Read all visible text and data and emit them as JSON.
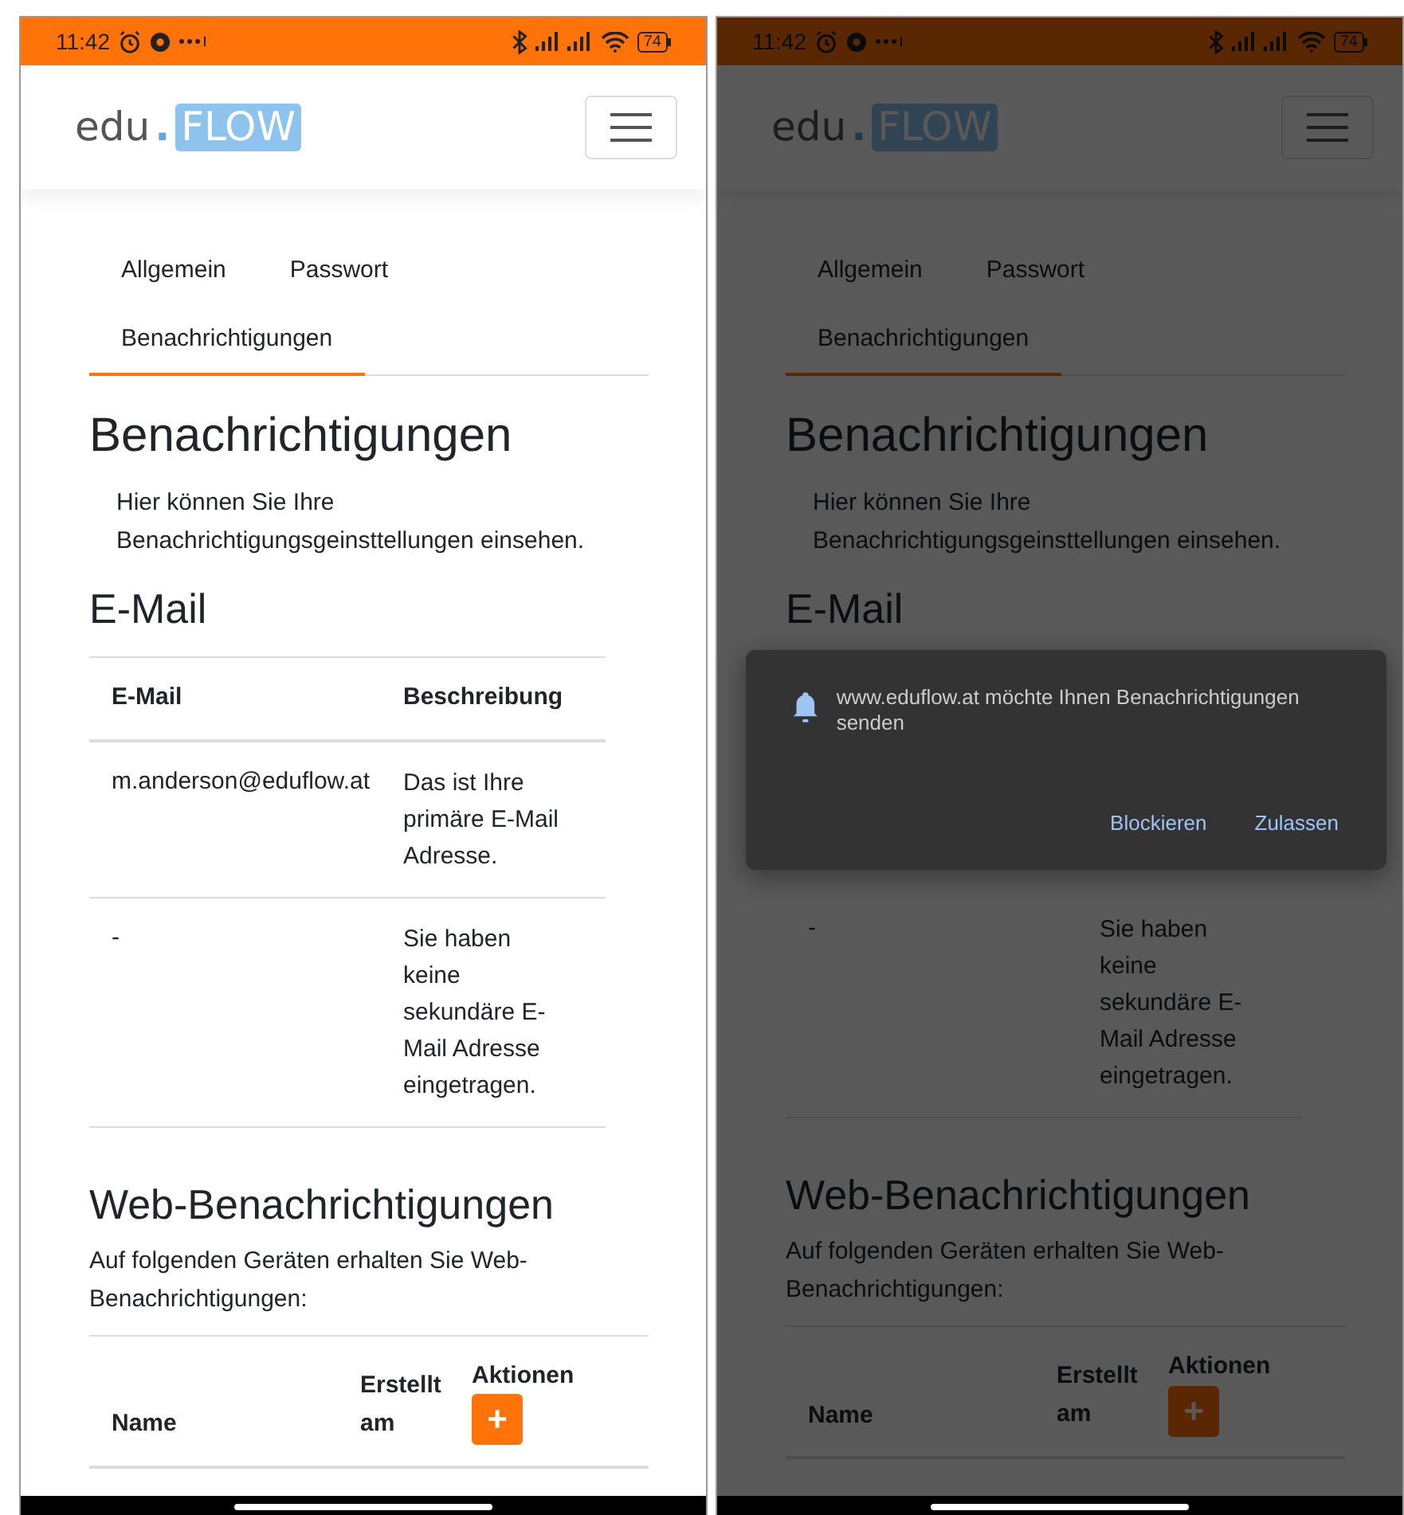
{
  "screens": [
    {
      "status_bar": {
        "time": "11:42",
        "battery": "74"
      },
      "logo": {
        "prefix": "edu",
        "dot": ".",
        "highlight": "FLOW"
      },
      "tabs": [
        {
          "label": "Allgemein",
          "selected": false
        },
        {
          "label": "Passwort",
          "selected": false
        },
        {
          "label": "Benachrichtigungen",
          "selected": true
        }
      ],
      "title": "Benachrichtigungen",
      "intro": "Hier können Sie Ihre Benachrichtigungsgeinsttellungen einsehen.",
      "email_section": {
        "heading": "E-Mail",
        "columns": [
          "E-Mail",
          "Beschreibung"
        ],
        "rows": [
          {
            "email": "m.anderson@eduflow.at",
            "description": "Das ist Ihre primäre E-Mail Adresse."
          },
          {
            "email": "-",
            "description": "Sie haben keine sekundäre E-Mail Adresse eingetragen."
          }
        ]
      },
      "web_section": {
        "heading": "Web-Benachrichtigungen",
        "intro": "Auf folgenden Geräten erhalten Sie Web-Benachrichtigungen:",
        "columns": [
          "Name",
          "Erstellt am",
          "Aktionen"
        ],
        "add_button": "+"
      }
    },
    {
      "status_bar": {
        "time": "11:42",
        "battery": "74"
      },
      "logo": {
        "prefix": "edu",
        "dot": ".",
        "highlight": "FLOW"
      },
      "tabs": [
        {
          "label": "Allgemein",
          "selected": false
        },
        {
          "label": "Passwort",
          "selected": false
        },
        {
          "label": "Benachrichtigungen",
          "selected": true
        }
      ],
      "title": "Benachrichtigungen",
      "intro": "Hier können Sie Ihre Benachrichtigungsgeinsttellungen einsehen.",
      "email_section": {
        "heading": "E-Mail",
        "rows": [
          {
            "email": "-",
            "description": "Sie haben keine sekundäre E-Mail Adresse eingetragen."
          }
        ]
      },
      "web_section": {
        "heading": "Web-Benachrichtigungen",
        "intro": "Auf folgenden Geräten erhalten Sie Web-Benachrichtigungen:",
        "columns": [
          "Name",
          "Erstellt am",
          "Aktionen"
        ],
        "add_button": "+"
      },
      "permission_prompt": {
        "message": "www.eduflow.at möchte Ihnen Benachrichtigungen senden",
        "buttons": [
          "Blockieren",
          "Zulassen"
        ]
      }
    }
  ]
}
